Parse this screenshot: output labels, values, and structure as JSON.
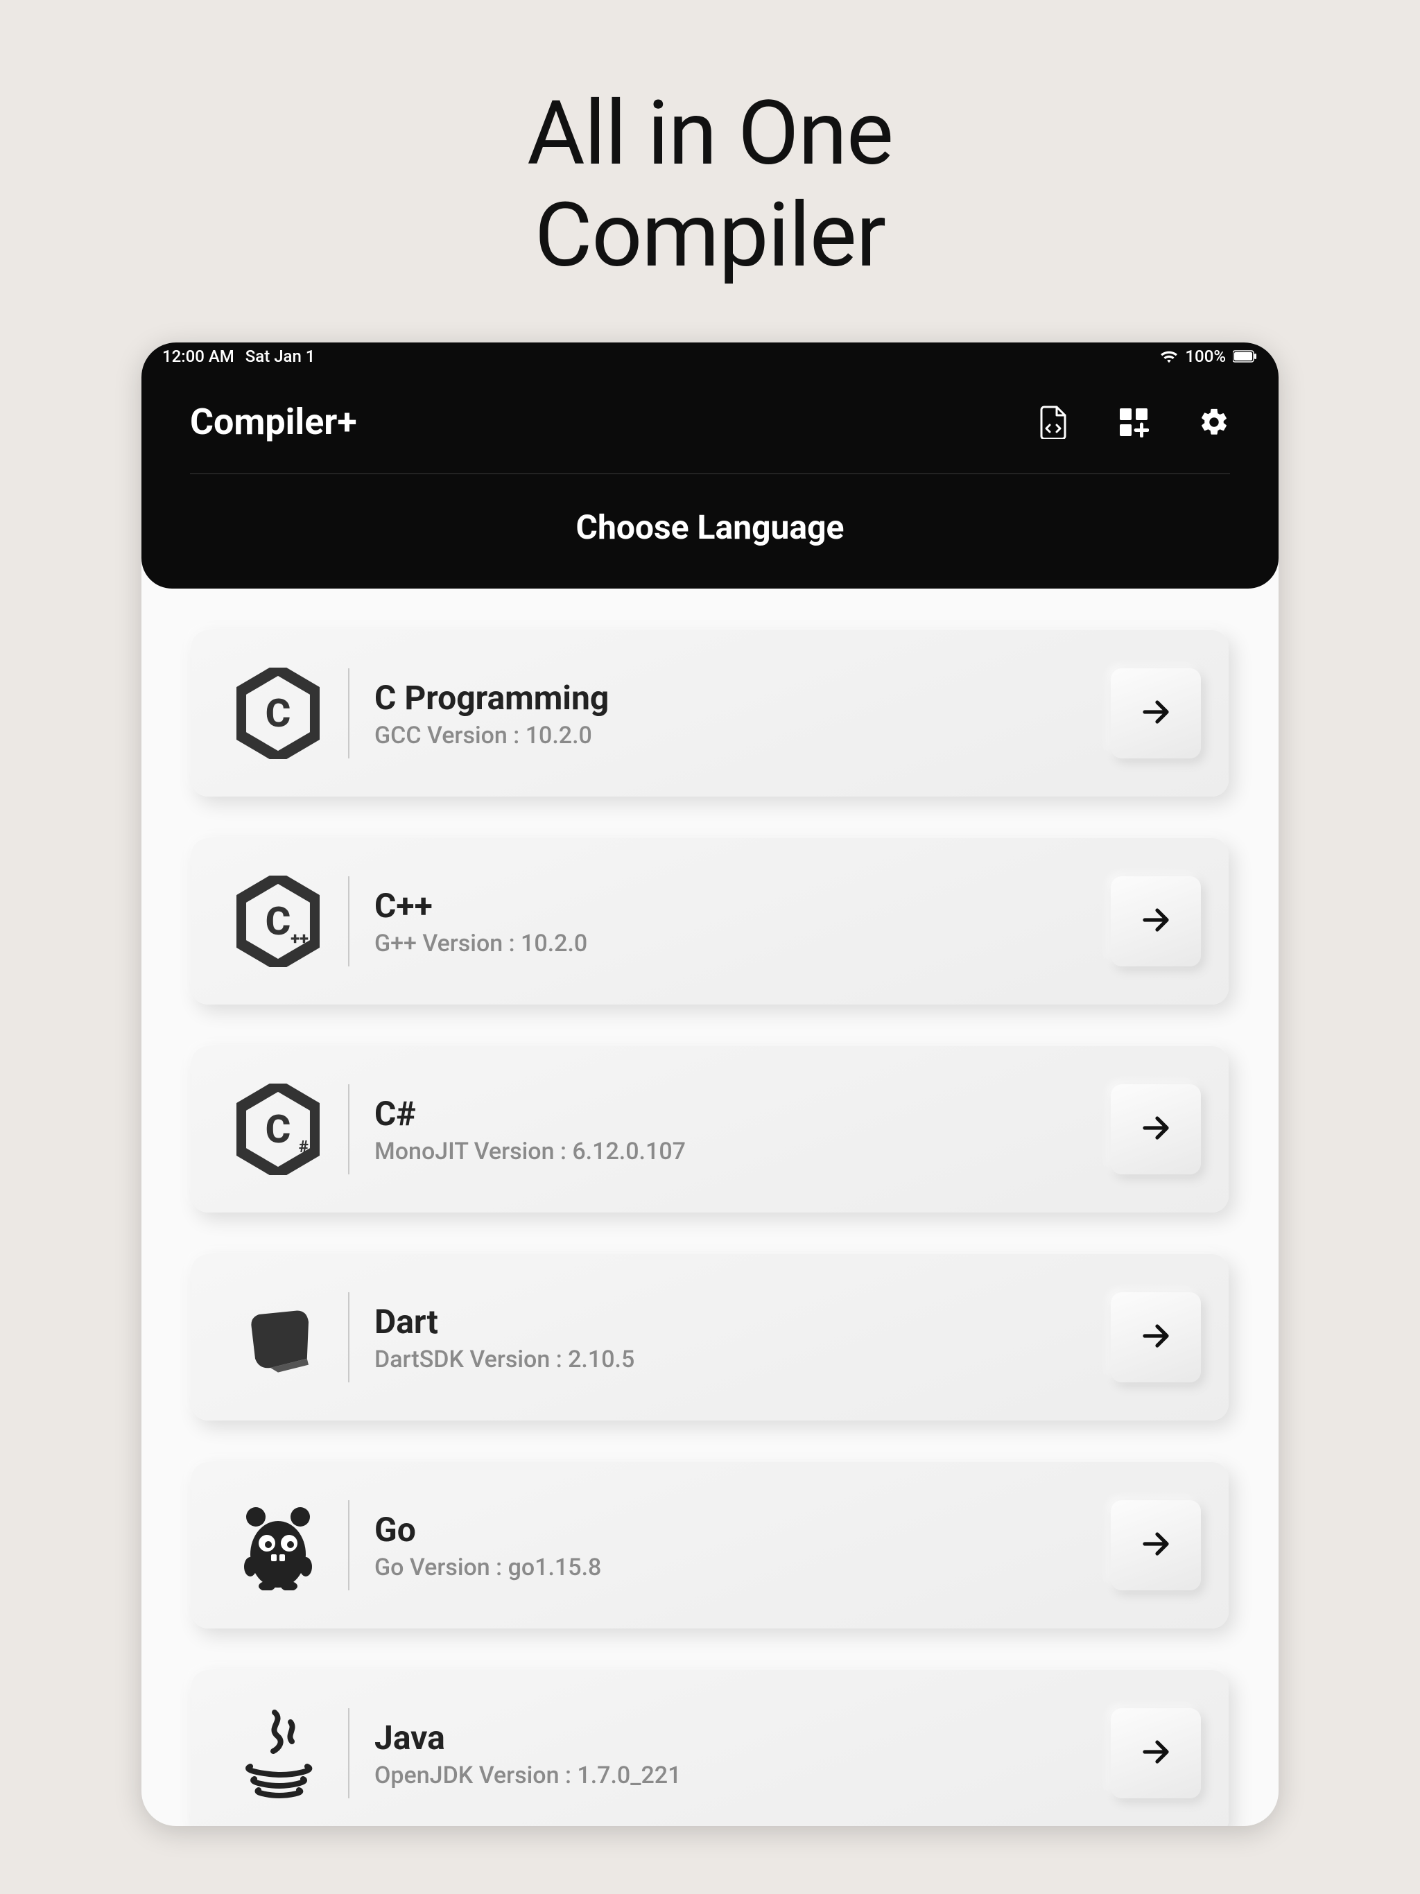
{
  "page": {
    "title_line1": "All in One",
    "title_line2": "Compiler"
  },
  "status": {
    "time": "12:00 AM",
    "date": "Sat Jan 1",
    "battery": "100%"
  },
  "header": {
    "app_title": "Compiler+",
    "section_title": "Choose Language"
  },
  "languages": [
    {
      "id": "c",
      "name": "C Programming",
      "subtitle": "GCC Version : 10.2.0",
      "icon": "hex",
      "letter": "C",
      "badge": ""
    },
    {
      "id": "cpp",
      "name": "C++",
      "subtitle": "G++ Version : 10.2.0",
      "icon": "hex",
      "letter": "C",
      "badge": "++"
    },
    {
      "id": "csharp",
      "name": "C#",
      "subtitle": "MonoJIT Version : 6.12.0.107",
      "icon": "hex",
      "letter": "C",
      "badge": "#"
    },
    {
      "id": "dart",
      "name": "Dart",
      "subtitle": "DartSDK Version : 2.10.5",
      "icon": "dart"
    },
    {
      "id": "go",
      "name": "Go",
      "subtitle": "Go Version : go1.15.8",
      "icon": "gopher"
    },
    {
      "id": "java",
      "name": "Java",
      "subtitle": "OpenJDK Version : 1.7.0_221",
      "icon": "java"
    }
  ]
}
